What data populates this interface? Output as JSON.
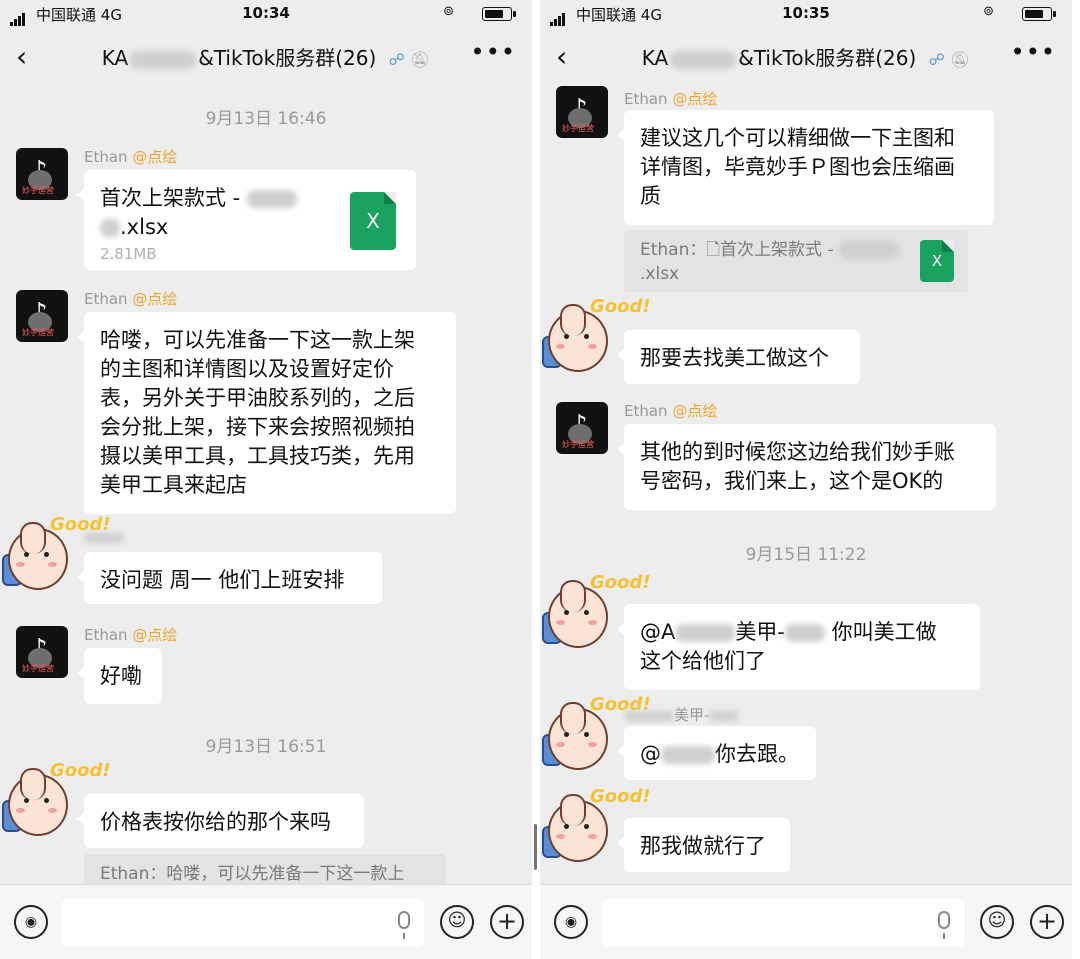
{
  "left": {
    "status": {
      "carrier": "中国联通",
      "network": "4G",
      "time": "10:34"
    },
    "nav": {
      "back": "‹",
      "title_prefix": "KA",
      "title_suffix": "&TikTok服务群(26)",
      "more": "•••"
    },
    "timestamp1": "9月13日 16:46",
    "msg1": {
      "sender": "Ethan",
      "at": "@点绘",
      "file_prefix": "首次上架款式 -",
      "file_ext": ".xlsx",
      "file_size": "2.81MB",
      "file_icon": "X"
    },
    "msg2": {
      "sender": "Ethan",
      "at": "@点绘",
      "lines": [
        "哈喽，可以先准备一下这一款上架",
        "的主图和详情图以及设置好定价",
        "表，另外关于甲油胶系列的，之后",
        "会分批上架，接下来会按照视频拍",
        "摄以美甲工具，工具技巧类，先用",
        "美甲工具来起店"
      ]
    },
    "msg3": {
      "text": "没问题  周一 他们上班安排"
    },
    "msg4": {
      "sender": "Ethan",
      "at": "@点绘",
      "text": "好嘞"
    },
    "timestamp2": "9月13日 16:51",
    "msg5": {
      "text": "价格表按你给的那个来吗",
      "quote": "Ethan：哈喽，可以先准备一下这一款上"
    },
    "sticker_label": "Good!"
  },
  "right": {
    "status": {
      "carrier": "中国联通",
      "network": "4G",
      "time": "10:35"
    },
    "nav": {
      "back": "‹",
      "title_prefix": "KA",
      "title_suffix": "&TikTok服务群(26)",
      "more": "•••"
    },
    "msg1": {
      "sender": "Ethan",
      "at": "@点绘",
      "lines": [
        "建议这几个可以精细做一下主图和",
        "详情图，毕竟妙手Ｐ图也会压缩画",
        "质"
      ],
      "quote_prefix": "Ethan：",
      "quote_file": "首次上架款式 -",
      "quote_ext": ".xlsx",
      "file_icon": "X"
    },
    "msg2": {
      "text": "那要去找美工做这个"
    },
    "msg3": {
      "sender": "Ethan",
      "at": "@点绘",
      "lines": [
        "其他的到时候您这边给我们妙手账",
        "号密码，我们来上，这个是OK的"
      ]
    },
    "timestamp1": "9月15日 11:22",
    "msg4": {
      "prefix": "@A",
      "mid": "美甲-",
      "suffix": "你叫美工做",
      "line2": "这个给他们了"
    },
    "msg5": {
      "name_mid": "美甲-",
      "prefix": "@",
      "suffix": "你去跟。"
    },
    "msg6": {
      "text": "那我做就行了"
    },
    "sticker_label": "Good!"
  }
}
